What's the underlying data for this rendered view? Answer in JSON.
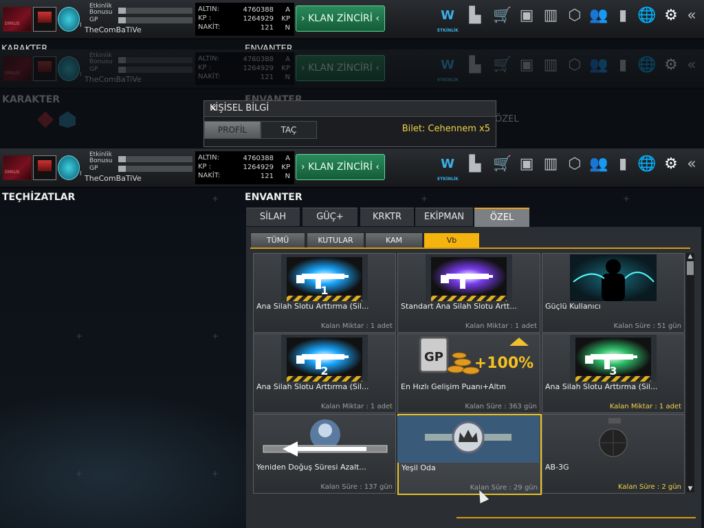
{
  "player": {
    "name": "TheComBaTiVe",
    "rank_numeral": "I",
    "labels": {
      "event_bonus_1": "Etkinlik",
      "event_bonus_2": "Bonusu",
      "gp": "GP"
    },
    "gp_progress": 0.1,
    "bonus_progress": 0.1
  },
  "currency": {
    "altin_label": "ALTIN:",
    "altin_value": "4760388",
    "altin_unit": "A",
    "kp_label": "KP :",
    "kp_value": "1264929",
    "kp_unit": "KP",
    "nakit_label": "NAKİT:",
    "nakit_value": "121",
    "nakit_unit": "N"
  },
  "klan_button": "KLAN ZİNCİRİ",
  "top_icons": [
    {
      "name": "etkinlik-icon",
      "glyph": "W",
      "caption": "ETKİNLİK"
    },
    {
      "name": "ranking-icon",
      "glyph": "▙"
    },
    {
      "name": "shop-cart-icon",
      "glyph": "🛒"
    },
    {
      "name": "briefcase-icon",
      "glyph": "▣"
    },
    {
      "name": "equipment-icon",
      "glyph": "▥"
    },
    {
      "name": "box-icon",
      "glyph": "⬡"
    },
    {
      "name": "friends-icon",
      "glyph": "👥"
    },
    {
      "name": "stats-icon",
      "glyph": "▮"
    },
    {
      "name": "globe-icon",
      "glyph": "🌐"
    },
    {
      "name": "gear-icon",
      "glyph": "⚙"
    },
    {
      "name": "back-arrow-icon",
      "glyph": "«"
    }
  ],
  "ghost_labels": {
    "karakter": "KARAKTER",
    "envanter": "ENVANTER",
    "ozel": "ÖZEL"
  },
  "popup": {
    "title": "KİŞİSEL BİLGİ",
    "close": "×",
    "tabs": [
      "PROFİL",
      "TAÇ"
    ],
    "ticket": "Bilet: Cehennem x5"
  },
  "sections": {
    "left": "TEÇHİZATLAR",
    "right": "ENVANTER"
  },
  "tabs": [
    "SİLAH",
    "GÜÇ+",
    "KRKTR",
    "EKİPMAN",
    "ÖZEL"
  ],
  "selected_tab": "ÖZEL",
  "sub_tabs": [
    "TÜMÜ",
    "KUTULAR",
    "KAM",
    "Vb"
  ],
  "selected_sub_tab": "Vb",
  "items": [
    {
      "name": "Ana Silah Slotu Arttırma (Sil...",
      "info": "Kalan Miktar : 1 adet",
      "info_highlight": false,
      "art": "slot1"
    },
    {
      "name": "Standart Ana Silah Slotu Artt...",
      "info": "Kalan Miktar : 1 adet",
      "info_highlight": false,
      "art": "slot-purple"
    },
    {
      "name": "Güçlü Kullanıcı",
      "info": "Kalan Süre : 51 gün",
      "info_highlight": false,
      "art": "soldier"
    },
    {
      "name": "Ana Silah Slotu Arttırma (Sil...",
      "info": "Kalan Miktar : 1 adet",
      "info_highlight": false,
      "art": "slot2"
    },
    {
      "name": "En Hızlı Gelişim Puanı+Altın",
      "info": "Kalan Süre : 363 gün",
      "info_highlight": false,
      "art": "gp100"
    },
    {
      "name": "Ana Silah Slotu Arttırma (Sil...",
      "info": "Kalan Miktar : 1 adet",
      "info_highlight": true,
      "art": "slot3"
    },
    {
      "name": "Yeniden Doğuş Süresi Azalt...",
      "info": "Kalan Süre : 137 gün",
      "info_highlight": false,
      "art": "respawn"
    },
    {
      "name": "Yeşil Oda",
      "info": "Kalan Süre : 29 gün",
      "info_highlight": false,
      "art": "crown"
    },
    {
      "name": "AB-3G",
      "info": "Kalan Süre : 2 gün",
      "info_highlight": true,
      "art": "grenade"
    }
  ],
  "art_text": {
    "gp_box": "GP",
    "gp_bonus": "+100%",
    "slot_numbers": [
      "1",
      "2",
      "3"
    ]
  },
  "colors": {
    "accent": "#f5b30f",
    "klan_green": "#1f7a4c",
    "gold_text": "#f2d34a"
  }
}
